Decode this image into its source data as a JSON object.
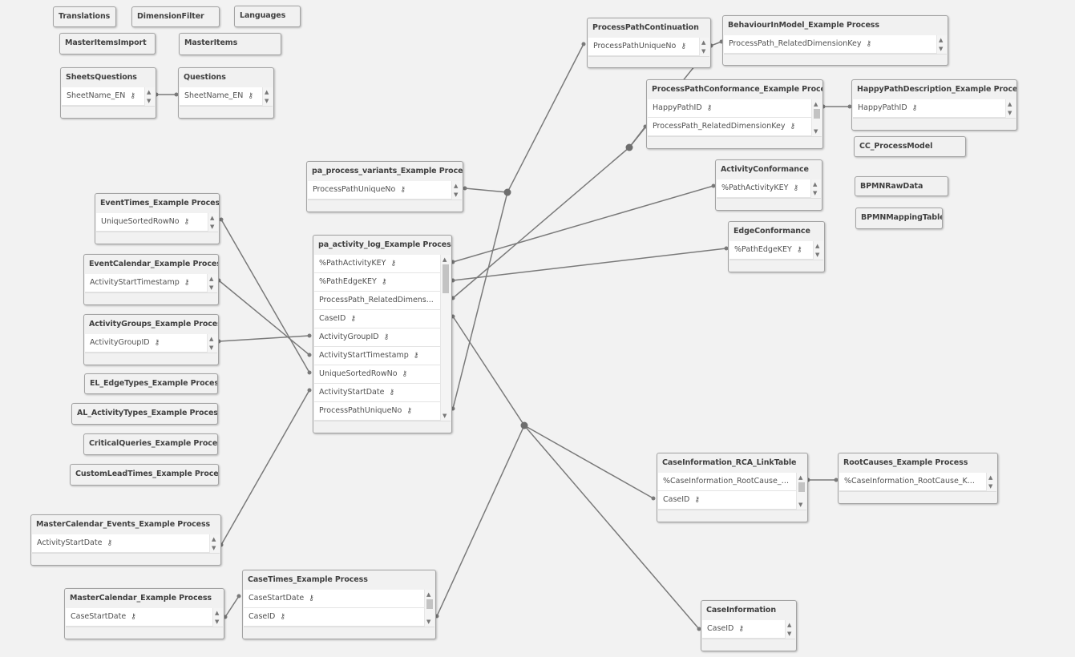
{
  "tables": [
    {
      "name": "Translations",
      "fields": []
    },
    {
      "name": "DimensionFilter",
      "fields": []
    },
    {
      "name": "Languages",
      "fields": []
    },
    {
      "name": "MasterItemsImport",
      "fields": []
    },
    {
      "name": "MasterItems",
      "fields": []
    },
    {
      "name": "SheetsQuestions",
      "fields": [
        "SheetName_EN"
      ]
    },
    {
      "name": "Questions",
      "fields": [
        "SheetName_EN"
      ]
    },
    {
      "name": "ProcessPathContinuation",
      "fields": [
        "ProcessPathUniqueNo"
      ]
    },
    {
      "name": "BehaviourInModel_Example Process",
      "fields": [
        "ProcessPath_RelatedDimensionKey"
      ]
    },
    {
      "name": "ProcessPathConformance_Example Process",
      "fields": [
        "HappyPathID",
        "ProcessPath_RelatedDimensionKey"
      ]
    },
    {
      "name": "HappyPathDescription_Example Process",
      "fields": [
        "HappyPathID"
      ]
    },
    {
      "name": "CC_ProcessModel",
      "fields": []
    },
    {
      "name": "BPMNRawData",
      "fields": []
    },
    {
      "name": "BPMNMappingTable",
      "fields": []
    },
    {
      "name": "pa_process_variants_Example Process",
      "fields": [
        "ProcessPathUniqueNo"
      ]
    },
    {
      "name": "ActivityConformance",
      "fields": [
        "%PathActivityKEY"
      ]
    },
    {
      "name": "EdgeConformance",
      "fields": [
        "%PathEdgeKEY"
      ]
    },
    {
      "name": "EventTimes_Example Process",
      "fields": [
        "UniqueSortedRowNo"
      ]
    },
    {
      "name": "pa_activity_log_Example Process",
      "fields": [
        "%PathActivityKEY",
        "%PathEdgeKEY",
        "ProcessPath_RelatedDimens...",
        "CaseID",
        "ActivityGroupID",
        "ActivityStartTimestamp",
        "UniqueSortedRowNo",
        "ActivityStartDate",
        "ProcessPathUniqueNo"
      ]
    },
    {
      "name": "EventCalendar_Example Process",
      "fields": [
        "ActivityStartTimestamp"
      ]
    },
    {
      "name": "ActivityGroups_Example Process",
      "fields": [
        "ActivityGroupID"
      ]
    },
    {
      "name": "EL_EdgeTypes_Example Process",
      "fields": []
    },
    {
      "name": "AL_ActivityTypes_Example Process",
      "fields": []
    },
    {
      "name": "CriticalQueries_Example Process",
      "fields": []
    },
    {
      "name": "CustomLeadTimes_Example Process",
      "fields": []
    },
    {
      "name": "MasterCalendar_Events_Example Process",
      "fields": [
        "ActivityStartDate"
      ]
    },
    {
      "name": "MasterCalendar_Example Process",
      "fields": [
        "CaseStartDate"
      ]
    },
    {
      "name": "CaseTimes_Example Process",
      "fields": [
        "CaseStartDate",
        "CaseID"
      ]
    },
    {
      "name": "CaseInformation_RCA_LinkTable",
      "fields": [
        "%CaseInformation_RootCause_KE...",
        "CaseID"
      ]
    },
    {
      "name": "RootCauses_Example Process",
      "fields": [
        "%CaseInformation_RootCause_K..."
      ]
    },
    {
      "name": "CaseInformation",
      "fields": [
        "CaseID"
      ]
    }
  ],
  "key_icon": "key-icon",
  "colors": {
    "background": "#f2f2f2",
    "link": "#7a7a7a"
  }
}
